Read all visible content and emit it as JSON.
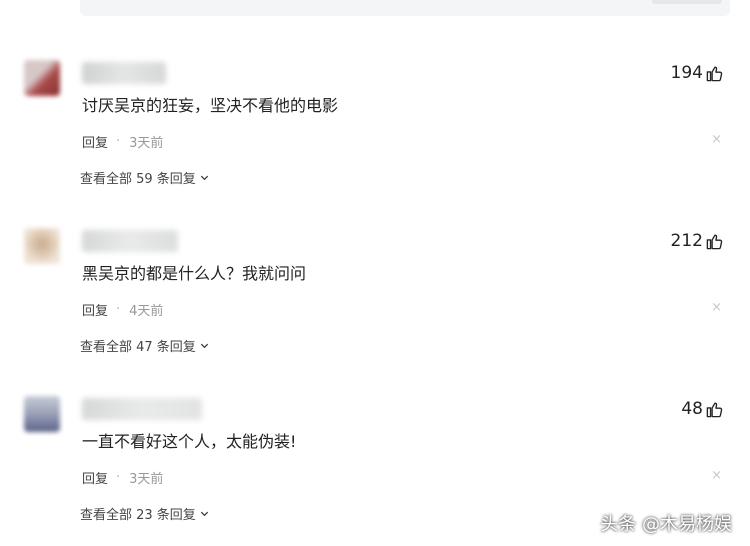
{
  "comments": [
    {
      "likes": "194",
      "text": "讨厌吴京的狂妄，坚决不看他的电影",
      "reply": "回复",
      "separator": "·",
      "time": "3天前",
      "view_all": "查看全部 59 条回复",
      "avatar_colors": [
        "#d7c8c8",
        "#a94a4a"
      ]
    },
    {
      "likes": "212",
      "text": "黑吴京的都是什么人？我就问问",
      "reply": "回复",
      "separator": "·",
      "time": "4天前",
      "view_all": "查看全部 47 条回复",
      "avatar_colors": [
        "#efe3d6",
        "#c9ab8d"
      ]
    },
    {
      "likes": "48",
      "text": "一直不看好这个人，太能伪装!",
      "reply": "回复",
      "separator": "·",
      "time": "3天前",
      "view_all": "查看全部 23 条回复",
      "avatar_colors": [
        "#c7cbd6",
        "#5a6288"
      ]
    }
  ],
  "close_glyph": "×",
  "watermark": "头条 @木易杨娱",
  "icons": {
    "like": "thumbs-up-icon",
    "expand": "chevron-down-icon",
    "close": "close-icon"
  }
}
